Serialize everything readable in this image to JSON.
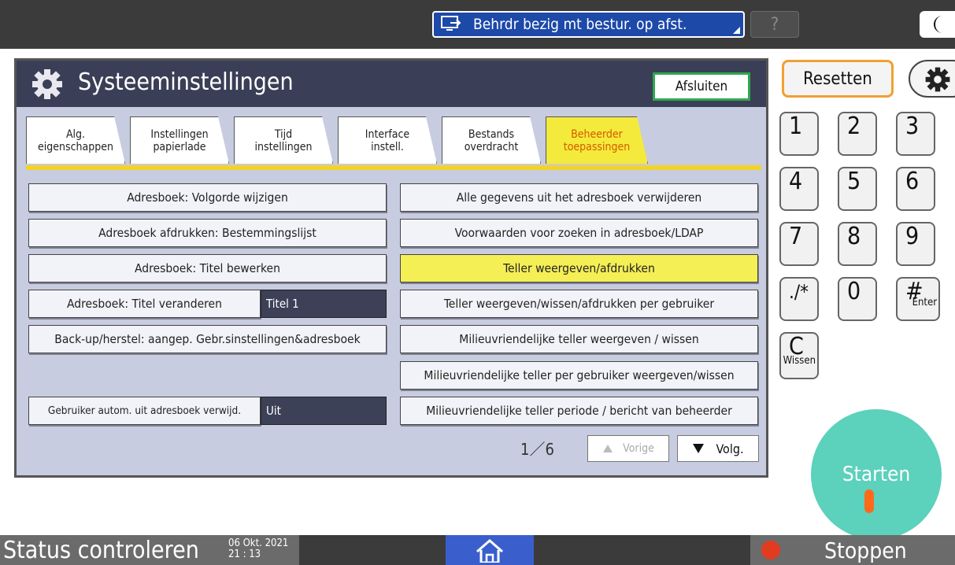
{
  "topbar": {
    "remote_label": "Behrdr bezig mt bestur. op afst.",
    "help_label": "?"
  },
  "panel": {
    "title": "Systeeminstellingen",
    "close_label": "Afsluiten",
    "tabs": [
      {
        "line1": "Alg.",
        "line2": "eigenschappen"
      },
      {
        "line1": "Instellingen",
        "line2": "papierlade"
      },
      {
        "line1": "Tijd",
        "line2": "instellingen"
      },
      {
        "line1": "Interface",
        "line2": "instell."
      },
      {
        "line1": "Bestands",
        "line2": "overdracht"
      },
      {
        "line1": "Beheerder",
        "line2": "toepassingen"
      }
    ],
    "left_buttons": [
      "Adresboek: Volgorde wijzigen",
      "Adresboek afdrukken: Bestemmingslijst",
      "Adresboek: Titel bewerken",
      "Adresboek: Titel veranderen",
      "Back-up/herstel: aangep. Gebr.sinstellingen&adresboek",
      "Gebruiker autom. uit adresboek verwijd."
    ],
    "left_values": [
      "Titel 1",
      "Uit"
    ],
    "right_buttons": [
      "Alle gegevens uit het adresboek verwijderen",
      "Voorwaarden voor zoeken in adresboek/LDAP",
      "Teller weergeven/afdrukken",
      "Teller weergeven/wissen/afdrukken per gebruiker",
      "Milieuvriendelijke teller weergeven / wissen",
      "Milieuvriendelijke teller per gebruiker weergeven/wissen",
      "Milieuvriendelijke teller periode / bericht van beheerder"
    ],
    "pager": "1／6",
    "prev_label": "Vorige",
    "next_label": "Volg."
  },
  "keypad": {
    "reset_label": "Resetten",
    "keys": [
      "1",
      "2",
      "3",
      "4",
      "5",
      "6",
      "7",
      "8",
      "9",
      "./*",
      "0",
      "#",
      "C"
    ],
    "enter_sub": "Enter",
    "clear_sub": "Wissen",
    "start_label": "Starten"
  },
  "bottombar": {
    "status_label": "Status controleren",
    "date": "06 Okt. 2021",
    "time": "21 : 13",
    "stop_label": "Stoppen"
  },
  "colors": {
    "accent_yellow": "#f5ef56",
    "title_bar": "#3a3f57",
    "start_green": "#5cd1bc"
  }
}
